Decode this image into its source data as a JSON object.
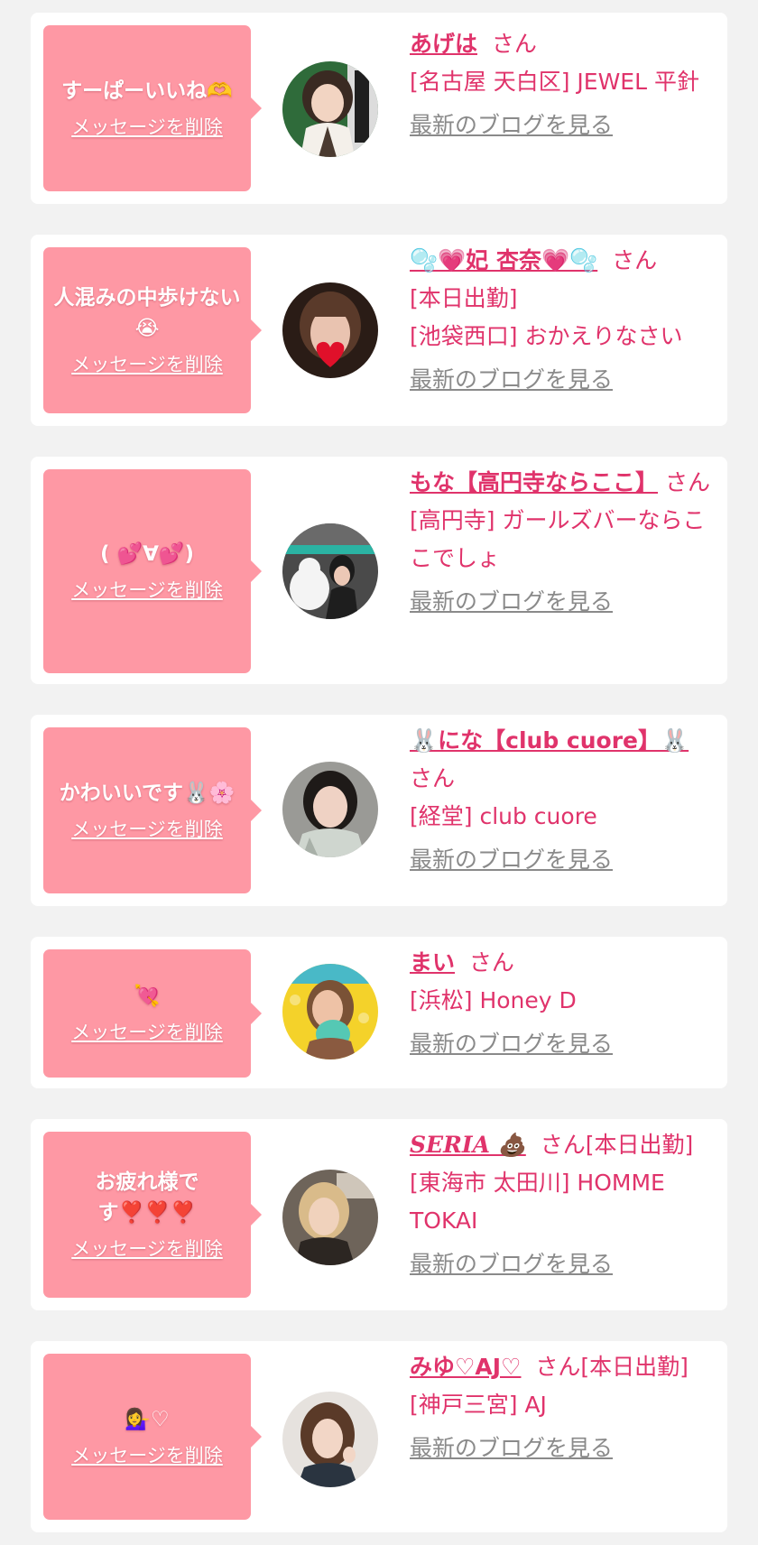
{
  "common": {
    "delete_label": "メッセージを削除",
    "blog_label": "最新のブログを見る",
    "honorific": "さん"
  },
  "colors": {
    "page_bg": "#f2f2f2",
    "card_bg": "#ffffff",
    "bubble_bg": "#fe98a4",
    "accent": "#e0336b",
    "blog_link": "#8a8a8a"
  },
  "messages": [
    {
      "message": "すーぱーいいね🫶",
      "name": "あげは",
      "suffix": "さん",
      "lines": [
        "[名古屋 天白区] JEWEL 平針"
      ]
    },
    {
      "message": "人混みの中歩けない😭",
      "name": "🫧💗妃 杏奈💗🫧",
      "suffix": "さん",
      "lines": [
        "[本日出勤]",
        "[池袋西口] おかえりなさい"
      ]
    },
    {
      "message": "( 💕∀💕)",
      "name": "もな【高円寺ならここ】",
      "suffix": "さん",
      "lines": [
        "[高円寺] ガールズバーならここでしょ"
      ]
    },
    {
      "message": "かわいいです🐰🌸",
      "name": "🐰にな【club cuore】🐰",
      "suffix": "さん",
      "lines": [
        "[経堂] club cuore"
      ]
    },
    {
      "message": "💘",
      "name": "まい",
      "suffix": "さん",
      "lines": [
        "[浜松] Honey D"
      ]
    },
    {
      "message": "お疲れ様です❣️❣️❣️",
      "name": "SERIA 💩",
      "suffix": "さん[本日出勤]",
      "lines": [
        "[東海市 太田川] HOMME TOKAI"
      ]
    },
    {
      "message": "💁‍♀️♡",
      "name": "みゆ♡AJ♡",
      "suffix": "さん[本日出勤]",
      "lines": [
        "[神戸三宮] AJ"
      ]
    }
  ]
}
